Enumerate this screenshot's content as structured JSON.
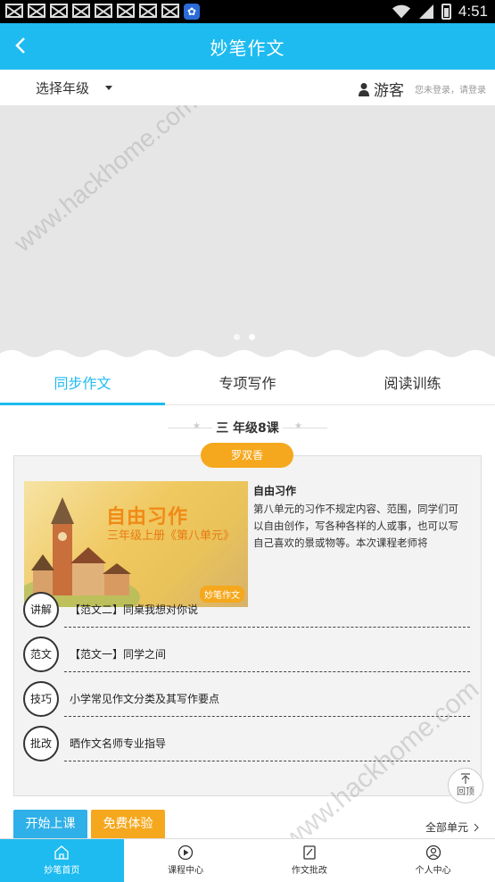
{
  "status_bar": {
    "time": "4:51"
  },
  "appbar": {
    "title": "妙笔作文"
  },
  "subbar": {
    "grade_select": "选择年级",
    "guest": "游客",
    "login_hint": "您未登录，请登录"
  },
  "watermarks": [
    "www.hackhome.com",
    "www.hackhome.com"
  ],
  "tabs": [
    {
      "label": "同步作文",
      "active": true
    },
    {
      "label": "专项写作",
      "active": false
    },
    {
      "label": "阅读训练",
      "active": false
    }
  ],
  "section": {
    "title": "三 年级8课"
  },
  "teacher": "罗双香",
  "lesson": {
    "image_title": "自由习作",
    "image_sub": "三年级上册《第八单元》",
    "image_logo": "妙笔作文",
    "title": "自由习作",
    "description": "第八单元的习作不规定内容、范围，同学们可以自由创作，写各种各样的人或事，也可以写自己喜欢的景或物等。本次课程老师将"
  },
  "items": [
    {
      "tag": "讲解",
      "text": "【范文二】同桌我想对你说"
    },
    {
      "tag": "范文",
      "text": "【范文一】同学之间"
    },
    {
      "tag": "技巧",
      "text": "小学常见作文分类及其写作要点"
    },
    {
      "tag": "批改",
      "text": "晒作文名师专业指导"
    }
  ],
  "back_top": "回顶",
  "buttons": {
    "start": "开始上课",
    "free": "免费体验",
    "all_units": "全部单元"
  },
  "nav": [
    {
      "label": "妙笔首页",
      "icon": "home-icon",
      "active": true
    },
    {
      "label": "课程中心",
      "icon": "play-icon",
      "active": false
    },
    {
      "label": "作文批改",
      "icon": "edit-icon",
      "active": false
    },
    {
      "label": "个人中心",
      "icon": "person-icon",
      "active": false
    }
  ],
  "colors": {
    "accent": "#1ebbf0",
    "orange": "#f5a81d",
    "button_blue": "#2fb0e8"
  }
}
